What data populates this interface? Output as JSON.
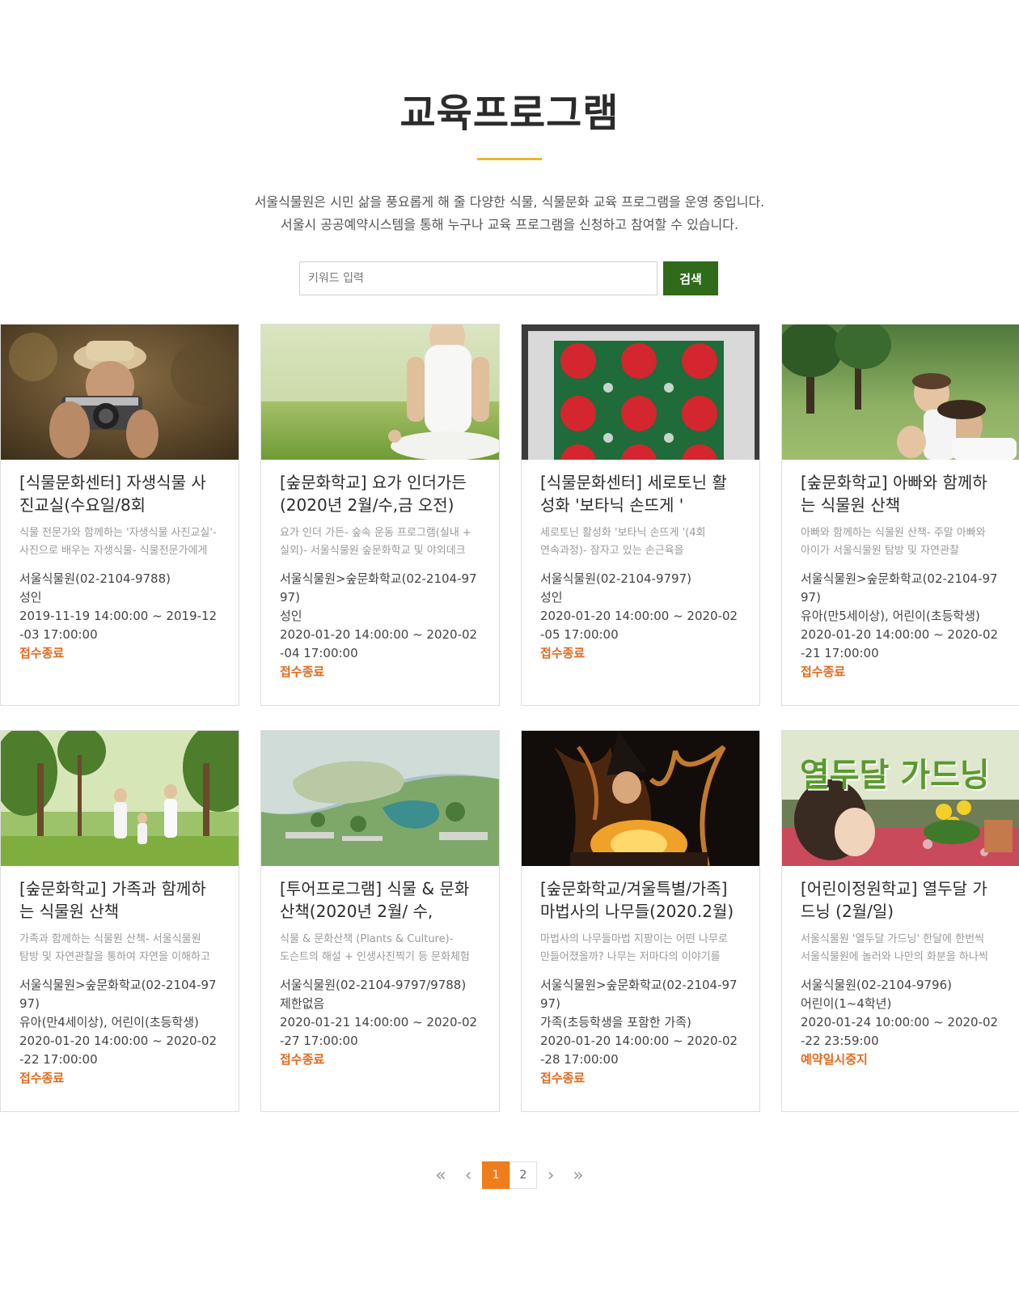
{
  "header": {
    "title": "교육프로그램",
    "intro_line1": "서울식물원은 시민 삶을 풍요롭게 해 줄 다양한 식물, 식물문화 교육 프로그램을 운영 중입니다.",
    "intro_line2": "서울시 공공예약시스템을 통해 누구나 교육 프로그램을 신청하고 참여할 수 있습니다."
  },
  "search": {
    "placeholder": "키워드 입력",
    "value": "",
    "button_label": "검색"
  },
  "programs": [
    {
      "title": "[식물문화센터] 자생식물 사진교실(수요일/8회",
      "desc1": "식물 전문가와 함께하는 '자생식물 사진교실'-",
      "desc2": "사진으로 배우는 자생식물- 식물전문가에게",
      "contact": "서울식물원(02-2104-9788)",
      "target": "성인",
      "period": "2019-11-19 14:00:00 ~ 2019-12-03 17:00:00",
      "status": "접수종료",
      "image": "camera-photographer-photo"
    },
    {
      "title": "[숲문화학교] 요가 인더가든 (2020년 2월/수,금 오전)",
      "desc1": "요가 인더 가든- 숲속 운동 프로그램(실내 +",
      "desc2": "실외)- 서울식물원 숲문화학교 및 야외데크",
      "contact": "서울식물원>숲문화학교(02-2104-9797)",
      "target": "성인",
      "period": "2020-01-20 14:00:00 ~ 2020-02-04 17:00:00",
      "status": "접수종료",
      "image": "yoga-on-grass-photo"
    },
    {
      "title": "[식물문화센터] 세로토닌 활성화 '보타닉 손뜨게 '",
      "desc1": "세로토닌 활성화 '보타닉 손뜨게 '(4회",
      "desc2": "연속과정)- 잠자고 있는 손근육을",
      "contact": "서울식물원(02-2104-9797)",
      "target": "성인",
      "period": "2020-01-20 14:00:00 ~ 2020-02-05 17:00:00",
      "status": "접수종료",
      "image": "crochet-cushion-photo"
    },
    {
      "title": "[숲문화학교] 아빠와 함께하는 식물원 산책",
      "desc1": "아빠와 함께하는 식물원 산책- 주말 아빠와",
      "desc2": "아이가 서울식물원 탐방 및 자연관찰",
      "contact": "서울식물원>숲문화학교(02-2104-9797)",
      "target": "유아(만5세이상), 어린이(초등학생)",
      "period": "2020-01-20 14:00:00 ~ 2020-02-21 17:00:00",
      "status": "접수종료",
      "image": "father-and-kids-photo"
    },
    {
      "title": "[숲문화학교] 가족과 함께하는 식물원 산책",
      "desc1": "가족과 함께하는 식물원 산책- 서울식물원",
      "desc2": "탐방 및 자연관찰을 통하여 자연을 이해하고",
      "contact": "서울식물원>숲문화학교(02-2104-9797)",
      "target": "유아(만4세이상), 어린이(초등학생)",
      "period": "2020-01-20 14:00:00 ~ 2020-02-22 17:00:00",
      "status": "접수종료",
      "image": "family-forest-walk-photo"
    },
    {
      "title": "[투어프로그램] 식물 & 문화산책(2020년 2월/ 수,",
      "desc1": "식물 & 문화산책 (Plants & Culture)-",
      "desc2": "도슨트의 해설 + 인생사진찍기 등 문화체험",
      "contact": "서울식물원(02-2104-9797/9788)",
      "target": "제한없음",
      "period": "2020-01-21 14:00:00 ~ 2020-02-27 17:00:00",
      "status": "접수종료",
      "image": "park-aerial-view-photo"
    },
    {
      "title": "[숲문화학교/겨울특별/가족] 마법사의 나무들(2020.2월)",
      "desc1": "마법사의 나무들마법 지팡이는 어떤 나무로",
      "desc2": "만들어졌을까? 나무는 저마다의 이야기를",
      "contact": "서울식물원>숲문화학교(02-2104-9797)",
      "target": "가족(초등학생을 포함한 가족)",
      "period": "2020-01-20 14:00:00 ~ 2020-02-28 17:00:00",
      "status": "접수종료",
      "image": "wizard-fire-photo"
    },
    {
      "title": "[어린이정원학교] 열두달 가드닝 (2월/일)",
      "desc1": "서울식물원 '열두달 가드닝' 한달에 한번씩",
      "desc2": "서울식물원에 놀러와 나만의 화분을 하나씩",
      "contact": "서울식물원(02-2104-9796)",
      "target": "어린이(1~4학년)",
      "period": "2020-01-24 10:00:00 ~ 2020-02-22 23:59:00",
      "status": "예약일시중지",
      "image": "kids-gardening-photo",
      "image_caption": "열두달 가드닝"
    }
  ],
  "pagination": {
    "first": "«",
    "prev": "‹",
    "next": "›",
    "last": "»",
    "pages": [
      "1",
      "2"
    ],
    "current": "1"
  },
  "colors": {
    "accent_yellow": "#e8b62c",
    "search_green": "#2f6b1a",
    "status_orange": "#e26a1d",
    "page_active": "#f07d1b"
  }
}
